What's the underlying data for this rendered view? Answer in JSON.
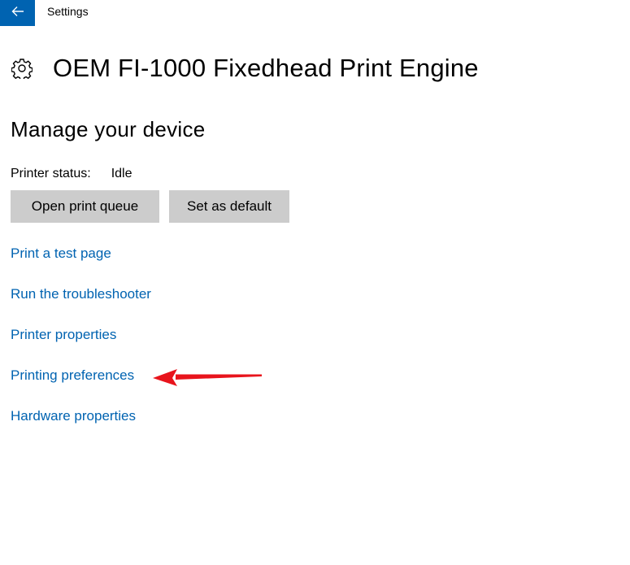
{
  "window": {
    "app_title": "Settings",
    "back_icon": "arrow-left-icon",
    "accent_color": "#0063b1"
  },
  "header": {
    "icon": "gear-icon",
    "title": "OEM FI-1000 Fixedhead Print Engine"
  },
  "manage": {
    "section_title": "Manage your device",
    "status_label": "Printer status:",
    "status_value": "Idle",
    "buttons": {
      "open_queue": "Open print queue",
      "set_default": "Set as default"
    },
    "links": [
      "Print a test page",
      "Run the troubleshooter",
      "Printer properties",
      "Printing preferences",
      "Hardware properties"
    ],
    "link_color": "#0063b1"
  },
  "annotation": {
    "type": "red-arrow-icon",
    "color": "#e8141c",
    "target": "Printing preferences"
  }
}
